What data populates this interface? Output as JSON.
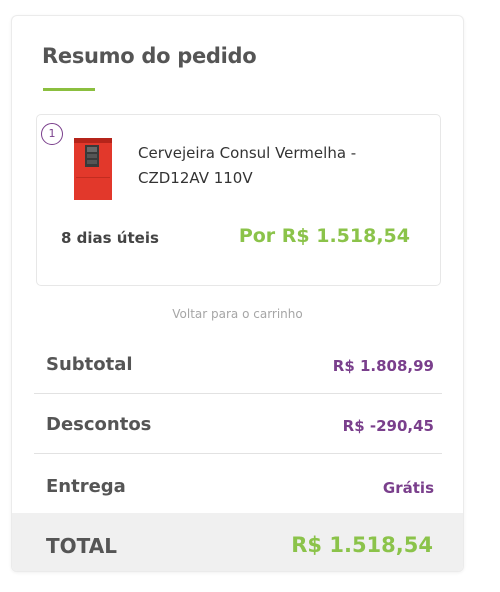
{
  "summary": {
    "title": "Resumo do pedido",
    "accent_color": "#8bc34a",
    "brand_color": "#7a3f8c"
  },
  "item": {
    "quantity": "1",
    "name": "Cervejeira Consul Vermelha - CZD12AV 110V",
    "image_icon": "red-beverage-cooler-image",
    "delivery_time": "8 dias úteis",
    "price": "Por R$ 1.518,54"
  },
  "back_link": "Voltar para o carrinho",
  "totals": {
    "subtotal_label": "Subtotal",
    "subtotal_value": "R$ 1.808,99",
    "discount_label": "Descontos",
    "discount_value": "R$ -290,45",
    "shipping_label": "Entrega",
    "shipping_value": "Grátis",
    "total_label": "TOTAL",
    "total_value": "R$ 1.518,54"
  }
}
